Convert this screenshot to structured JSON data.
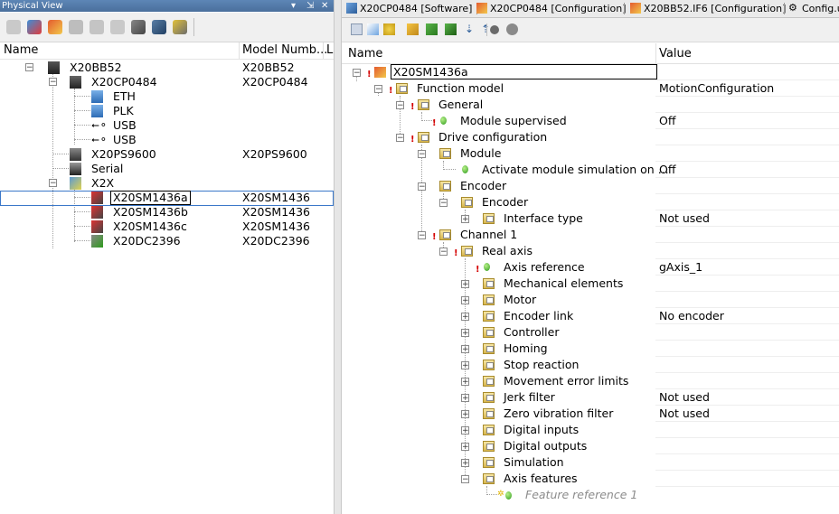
{
  "left_pane": {
    "title": "Physical View",
    "title_controls": [
      "▾",
      "⇲",
      "✕"
    ],
    "columns": [
      "Name",
      "Model Numb...",
      "L"
    ],
    "tree": [
      {
        "label": "X20BB52",
        "model": "X20BB52"
      },
      {
        "label": "X20CP0484",
        "model": "X20CP0484"
      },
      {
        "label": "ETH",
        "model": ""
      },
      {
        "label": "PLK",
        "model": ""
      },
      {
        "label": "USB",
        "model": ""
      },
      {
        "label": "USB",
        "model": ""
      },
      {
        "label": "X20PS9600",
        "model": "X20PS9600"
      },
      {
        "label": "Serial",
        "model": ""
      },
      {
        "label": "X2X",
        "model": ""
      },
      {
        "label": "X20SM1436a",
        "model": "X20SM1436"
      },
      {
        "label": "X20SM1436b",
        "model": "X20SM1436"
      },
      {
        "label": "X20SM1436c",
        "model": "X20SM1436"
      },
      {
        "label": "X20DC2396",
        "model": "X20DC2396"
      }
    ]
  },
  "tabs": [
    {
      "label": "X20CP0484 [Software]"
    },
    {
      "label": "X20CP0484 [Configuration]"
    },
    {
      "label": "X20BB52.IF6 [Configuration]"
    },
    {
      "label": "Config.u"
    }
  ],
  "right_pane": {
    "columns": [
      "Name",
      "Value"
    ],
    "rows": [
      {
        "label": "X20SM1436a",
        "value": ""
      },
      {
        "label": "Function model",
        "value": "MotionConfiguration"
      },
      {
        "label": "General",
        "value": ""
      },
      {
        "label": "Module supervised",
        "value": "Off"
      },
      {
        "label": "Drive configuration",
        "value": ""
      },
      {
        "label": "Module",
        "value": ""
      },
      {
        "label": "Activate module simulation on ...",
        "value": "Off"
      },
      {
        "label": "Encoder",
        "value": ""
      },
      {
        "label": "Encoder",
        "value": ""
      },
      {
        "label": "Interface type",
        "value": "Not used"
      },
      {
        "label": "Channel 1",
        "value": ""
      },
      {
        "label": "Real axis",
        "value": ""
      },
      {
        "label": "Axis reference",
        "value": "gAxis_1"
      },
      {
        "label": "Mechanical elements",
        "value": ""
      },
      {
        "label": "Motor",
        "value": ""
      },
      {
        "label": "Encoder link",
        "value": "No encoder"
      },
      {
        "label": "Controller",
        "value": ""
      },
      {
        "label": "Homing",
        "value": ""
      },
      {
        "label": "Stop reaction",
        "value": ""
      },
      {
        "label": "Movement error limits",
        "value": ""
      },
      {
        "label": "Jerk filter",
        "value": "Not used"
      },
      {
        "label": "Zero vibration filter",
        "value": "Not used"
      },
      {
        "label": "Digital inputs",
        "value": ""
      },
      {
        "label": "Digital outputs",
        "value": ""
      },
      {
        "label": "Simulation",
        "value": ""
      },
      {
        "label": "Axis features",
        "value": ""
      },
      {
        "label": "Feature reference 1",
        "value": ""
      }
    ]
  },
  "colors": {
    "title_bar": "#4a6f9c",
    "error_mark": "#d40000",
    "ok_dot": "#2e9b1d",
    "selection_border": "#3b78c9",
    "placeholder_text": "#8c8c8c"
  }
}
